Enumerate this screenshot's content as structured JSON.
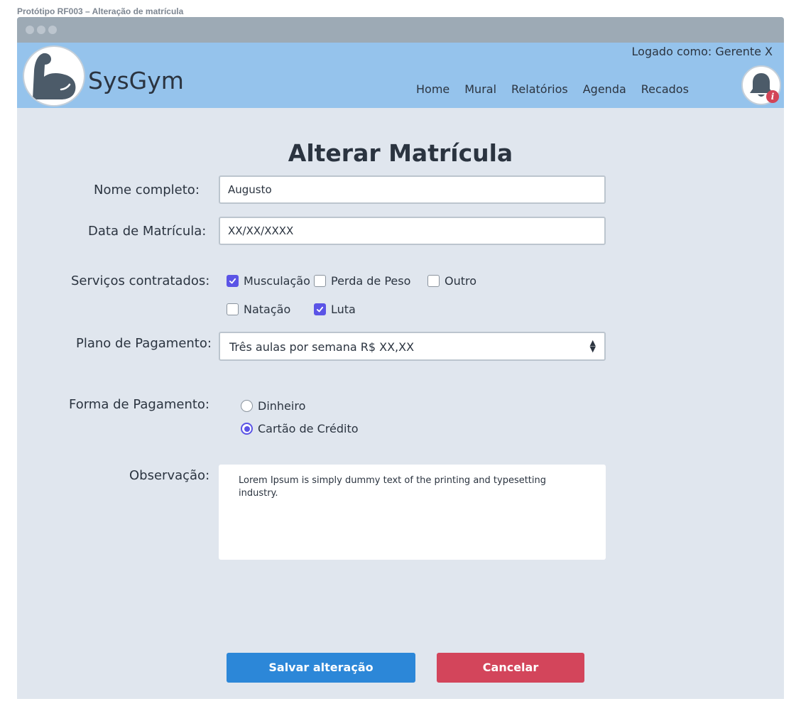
{
  "prototype_title": "Protótipo RF003 – Alteração de matrícula",
  "header": {
    "app_name": "SysGym",
    "logged_in": "Logado como: Gerente X",
    "nav": [
      "Home",
      "Mural",
      "Relatórios",
      "Agenda",
      "Recados"
    ],
    "notification_badge": "i"
  },
  "form": {
    "title": "Alterar Matrícula",
    "name_label": "Nome completo:",
    "name_value": "Augusto",
    "date_label": "Data de Matrícula:",
    "date_value": "XX/XX/XXXX",
    "services_label": "Serviços contratados:",
    "services": [
      {
        "label": "Musculação",
        "checked": true
      },
      {
        "label": "Perda de Peso",
        "checked": false
      },
      {
        "label": "Outro",
        "checked": false
      },
      {
        "label": "Natação",
        "checked": false
      },
      {
        "label": "Luta",
        "checked": true
      }
    ],
    "plan_label": "Plano de Pagamento:",
    "plan_value": "Três aulas por semana R$ XX,XX",
    "payment_label": "Forma de Pagamento:",
    "payment_options": [
      {
        "label": "Dinheiro",
        "selected": false
      },
      {
        "label": "Cartão de Crédito",
        "selected": true
      }
    ],
    "notes_label": "Observação:",
    "notes_value": "Lorem Ipsum is simply dummy text of the printing and typesetting industry."
  },
  "actions": {
    "save": "Salvar alteração",
    "cancel": "Cancelar"
  },
  "colors": {
    "header_bg": "#95c3ec",
    "content_bg": "#e0e6ee",
    "accent": "#5b54e6",
    "save_button": "#2c87d8",
    "cancel_button": "#d3455b"
  },
  "icons": {
    "logo": "flexed-arm-icon",
    "notifications": "bell-icon",
    "checked": "checkmark-icon"
  }
}
